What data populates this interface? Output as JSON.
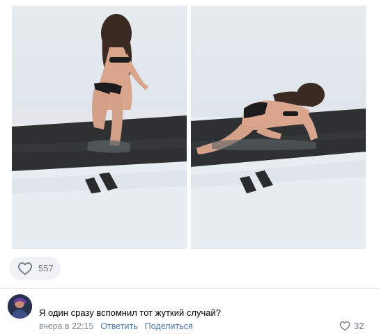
{
  "post": {
    "likes": "557"
  },
  "comment": {
    "text": "Я один сразу вспомнил тот жуткий случай?",
    "time": "вчера в 22:15",
    "reply_label": "Ответить",
    "share_label": "Поделиться",
    "likes": "32"
  },
  "colors": {
    "link": "#4a76a8",
    "muted": "#818c99",
    "pill_bg": "#f0f2f5",
    "divider": "#e7e8ec"
  },
  "icons": {
    "post_like": "heart-outline-icon",
    "comment_like": "heart-outline-icon"
  }
}
